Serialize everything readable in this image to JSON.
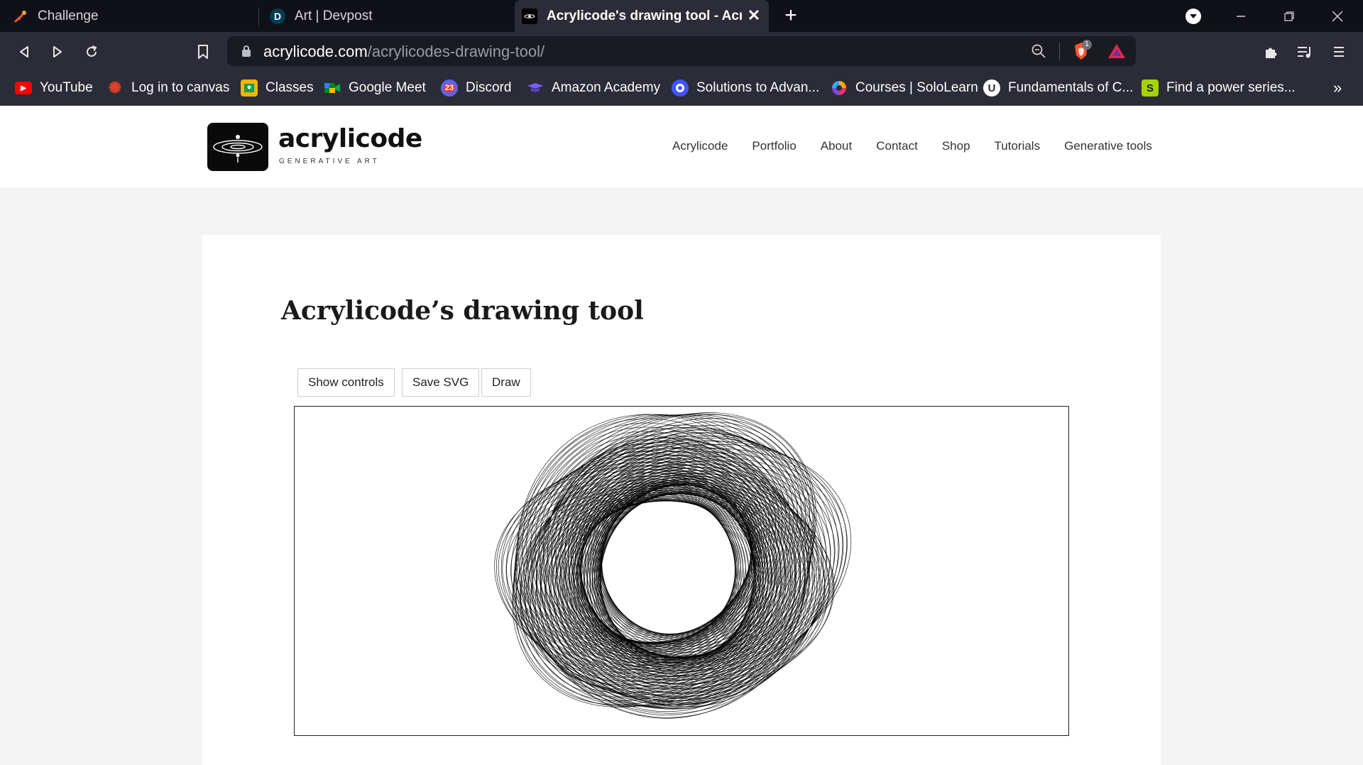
{
  "browser": {
    "tabs": [
      {
        "title": "Challenge",
        "icon": "challenge-favicon"
      },
      {
        "title": "Art | Devpost",
        "icon": "devpost-favicon"
      },
      {
        "title": "Acrylicode's drawing tool - Acrylic",
        "icon": "acrylicode-favicon",
        "active": true
      }
    ],
    "new_tab_label": "+",
    "address": {
      "host": "acrylicode.com",
      "path": "/acrylicodes-drawing-tool/"
    },
    "shield_badge": "1",
    "bookmarks": [
      {
        "label": "YouTube",
        "icon": "youtube-icon",
        "color": "#ff0000",
        "glyph": "▶"
      },
      {
        "label": "Log in to canvas",
        "icon": "canvas-icon",
        "color": "#e13f2b",
        "glyph": "✺"
      },
      {
        "label": "Classes",
        "icon": "classroom-icon",
        "color": "#f6b400",
        "glyph": "▣"
      },
      {
        "label": "Google Meet",
        "icon": "meet-icon",
        "color": "#00832d",
        "glyph": "■"
      },
      {
        "label": "Discord",
        "icon": "discord-icon",
        "color": "#5865f2",
        "glyph": "23"
      },
      {
        "label": "Amazon Academy",
        "icon": "amazon-academy-icon",
        "color": "#5b3fd6",
        "glyph": "▼"
      },
      {
        "label": "Solutions to Advan...",
        "icon": "quizlet-icon",
        "color": "#4255ff",
        "glyph": "Q"
      },
      {
        "label": "Courses | SoloLearn",
        "icon": "sololearn-icon",
        "color": "#7a4bd8",
        "glyph": "◎"
      },
      {
        "label": "Fundamentals of C...",
        "icon": "udemy-icon",
        "color": "#ffffff",
        "glyph": "U"
      },
      {
        "label": "Find a power series...",
        "icon": "slader-icon",
        "color": "#a6d400",
        "glyph": "S"
      }
    ],
    "more_bookmarks": "»"
  },
  "site": {
    "logo": {
      "name": "acrylicode",
      "tagline": "GENERATIVE ART"
    },
    "nav": [
      "Acrylicode",
      "Portfolio",
      "About",
      "Contact",
      "Shop",
      "Tutorials",
      "Generative tools"
    ]
  },
  "page": {
    "title": "Acrylicode’s drawing tool",
    "buttons": {
      "show_controls": "Show controls",
      "save_svg": "Save SVG",
      "draw": "Draw"
    }
  }
}
